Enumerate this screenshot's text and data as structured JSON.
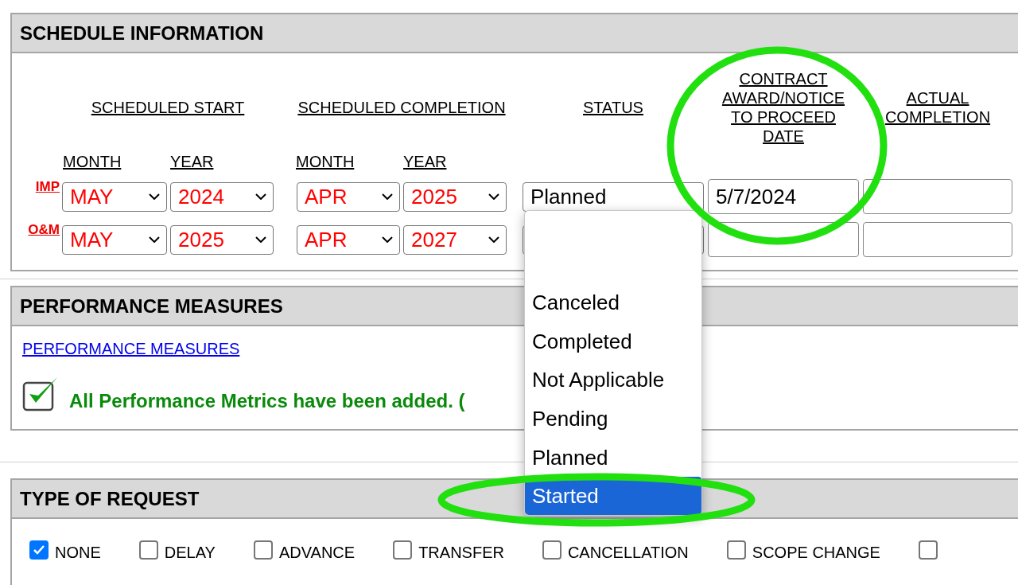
{
  "schedule": {
    "title": "SCHEDULE INFORMATION",
    "group_headers": [
      "SCHEDULED START",
      "SCHEDULED COMPLETION"
    ],
    "status_header": "STATUS",
    "contract_header": "CONTRACT AWARD/NOTICE TO PROCEED DATE",
    "actual_header": "ACTUAL COMPLETION",
    "sub_headers": [
      "MONTH",
      "YEAR",
      "MONTH",
      "YEAR"
    ],
    "rows": [
      {
        "label": "IMP",
        "start_month": "MAY",
        "start_year": "2024",
        "completion_month": "APR",
        "completion_year": "2025",
        "status": "Planned",
        "contract_date": "5/7/2024"
      },
      {
        "label": "O&M",
        "start_month": "MAY",
        "start_year": "2025",
        "completion_month": "APR",
        "completion_year": "2027"
      }
    ]
  },
  "status_dropdown": {
    "options": [
      {
        "label": "Canceled",
        "selected": false
      },
      {
        "label": "Completed",
        "selected": false
      },
      {
        "label": "Not Applicable",
        "selected": false
      },
      {
        "label": "Pending",
        "selected": false
      },
      {
        "label": "Planned",
        "selected": false
      },
      {
        "label": "Started",
        "selected": true
      }
    ]
  },
  "performance": {
    "title": "PERFORMANCE MEASURES",
    "link": "PERFORMANCE MEASURES",
    "message": "All Performance Metrics have been added. ("
  },
  "request_type": {
    "title": "TYPE OF REQUEST",
    "options": [
      {
        "label": "NONE",
        "checked": true
      },
      {
        "label": "DELAY",
        "checked": false
      },
      {
        "label": "ADVANCE",
        "checked": false
      },
      {
        "label": "TRANSFER",
        "checked": false
      },
      {
        "label": "CANCELLATION",
        "checked": false
      },
      {
        "label": "SCOPE CHANGE",
        "checked": false
      },
      {
        "checked": false
      }
    ]
  }
}
